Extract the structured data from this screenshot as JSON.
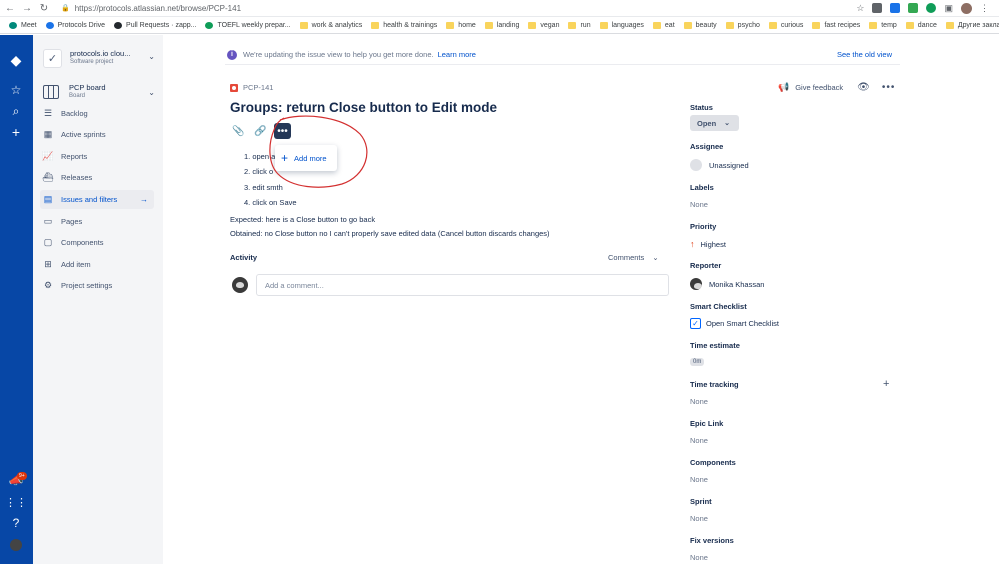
{
  "browser": {
    "url": "https://protocols.atlassian.net/browse/PCP-141",
    "bookmarks": [
      {
        "label": "Meet",
        "icon": "meet-icon",
        "color": "#00897b"
      },
      {
        "label": "Protocols Drive",
        "icon": "drive-icon",
        "color": "#1a73e8"
      },
      {
        "label": "Pull Requests · zapp...",
        "icon": "github-icon",
        "color": "#24292e"
      },
      {
        "label": "TOEFL weekly prepar...",
        "icon": "sheets-icon",
        "color": "#0f9d58"
      },
      {
        "label": "work & analytics",
        "icon": "folder-icon",
        "color": "#f9d45c"
      },
      {
        "label": "health & trainings",
        "icon": "folder-icon",
        "color": "#f9d45c"
      },
      {
        "label": "home",
        "icon": "folder-icon",
        "color": "#f9d45c"
      },
      {
        "label": "landing",
        "icon": "folder-icon",
        "color": "#f9d45c"
      },
      {
        "label": "vegan",
        "icon": "folder-icon",
        "color": "#f9d45c"
      },
      {
        "label": "run",
        "icon": "folder-icon",
        "color": "#f9d45c"
      },
      {
        "label": "languages",
        "icon": "folder-icon",
        "color": "#f9d45c"
      },
      {
        "label": "eat",
        "icon": "folder-icon",
        "color": "#f9d45c"
      },
      {
        "label": "beauty",
        "icon": "folder-icon",
        "color": "#f9d45c"
      },
      {
        "label": "psycho",
        "icon": "folder-icon",
        "color": "#f9d45c"
      },
      {
        "label": "curious",
        "icon": "folder-icon",
        "color": "#f9d45c"
      },
      {
        "label": "fast recipes",
        "icon": "folder-icon",
        "color": "#f9d45c"
      },
      {
        "label": "temp",
        "icon": "folder-icon",
        "color": "#f9d45c"
      },
      {
        "label": "dance",
        "icon": "folder-icon",
        "color": "#f9d45c"
      },
      {
        "label": "Другие закладки",
        "icon": "folder-icon",
        "color": "#f9d45c"
      }
    ]
  },
  "global_nav": {
    "notification_count": "9+"
  },
  "project": {
    "name": "protocols.io clou...",
    "type": "Software project",
    "board_name": "PCP board",
    "board_type": "Board",
    "nav_items": [
      {
        "label": "Backlog",
        "icon": "backlog-icon"
      },
      {
        "label": "Active sprints",
        "icon": "sprints-icon"
      },
      {
        "label": "Reports",
        "icon": "reports-icon"
      },
      {
        "label": "Releases",
        "icon": "releases-icon"
      },
      {
        "label": "Issues and filters",
        "icon": "issues-icon",
        "active": true
      },
      {
        "label": "Pages",
        "icon": "pages-icon"
      },
      {
        "label": "Components",
        "icon": "components-icon"
      },
      {
        "label": "Add item",
        "icon": "add-item-icon"
      },
      {
        "label": "Project settings",
        "icon": "settings-icon"
      }
    ]
  },
  "notice": {
    "text": "We're updating the issue view to help you get more done.",
    "link": "Learn more",
    "see_old": "See the old view"
  },
  "issue": {
    "key": "PCP-141",
    "summary": "Groups: return Close button to Edit mode",
    "give_feedback": "Give feedback",
    "steps": [
      "open a",
      "click o",
      "edit smth",
      "click on Save"
    ],
    "expected": "Expected: here is a Close button to go back",
    "obtained": "Obtained: no Close button no I can't properly save edited data (Cancel button discards changes)",
    "add_more_label": "Add more"
  },
  "activity": {
    "title": "Activity",
    "sort_label": "Comments",
    "comment_placeholder": "Add a comment..."
  },
  "fields": {
    "status_label": "Status",
    "status_value": "Open",
    "assignee_label": "Assignee",
    "assignee_value": "Unassigned",
    "labels_label": "Labels",
    "labels_value": "None",
    "priority_label": "Priority",
    "priority_value": "Highest",
    "reporter_label": "Reporter",
    "reporter_value": "Monika Khassan",
    "smart_checklist_label": "Smart Checklist",
    "smart_checklist_value": "Open Smart Checklist",
    "time_estimate_label": "Time estimate",
    "time_estimate_value": "0m",
    "time_tracking_label": "Time tracking",
    "time_tracking_value": "None",
    "epic_link_label": "Epic Link",
    "epic_link_value": "None",
    "components_label": "Components",
    "components_value": "None",
    "sprint_label": "Sprint",
    "sprint_value": "None",
    "fix_versions_label": "Fix versions",
    "fix_versions_value": "None"
  },
  "colors": {
    "global_nav": "#0747a6",
    "link": "#0052cc",
    "annotation": "#d32f2f"
  }
}
